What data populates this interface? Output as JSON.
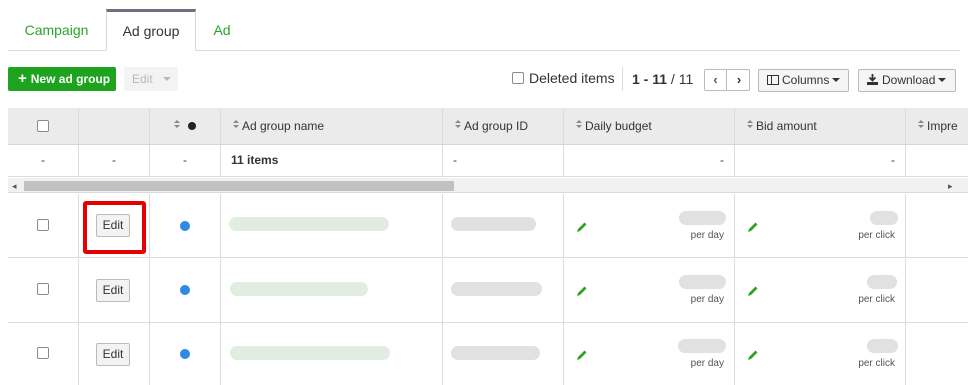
{
  "tabs": [
    {
      "label": "Campaign",
      "active": false
    },
    {
      "label": "Ad group",
      "active": true
    },
    {
      "label": "Ad",
      "active": false
    }
  ],
  "toolbar": {
    "new_label": "New ad group",
    "edit_label": "Edit",
    "deleted_label": "Deleted items",
    "range": "1 - 11",
    "total_sep": "/ 11",
    "prev_glyph": "‹",
    "next_glyph": "›",
    "columns_label": "Columns",
    "download_label": "Download"
  },
  "table": {
    "headers": {
      "name": "Ad group name",
      "id": "Ad group ID",
      "budget": "Daily budget",
      "bid": "Bid amount",
      "impr": "Impre"
    },
    "summary": {
      "c1": "-",
      "c2": "-",
      "c3": "-",
      "items": "11 items",
      "id": "-",
      "budget": "-",
      "bid": "-"
    },
    "rows": [
      {
        "edit_label": "Edit",
        "per_day": "per day",
        "per_click": "per click",
        "status_color": "#2e8ae6"
      },
      {
        "edit_label": "Edit",
        "per_day": "per day",
        "per_click": "per click",
        "status_color": "#2e8ae6"
      },
      {
        "edit_label": "Edit",
        "per_day": "per day",
        "per_click": "per click",
        "status_color": "#2e8ae6"
      }
    ]
  },
  "colors": {
    "accent_green": "#1da31d",
    "tab_green": "#2aa52a",
    "highlight_red": "#e60000",
    "status_blue": "#2e8ae6"
  }
}
